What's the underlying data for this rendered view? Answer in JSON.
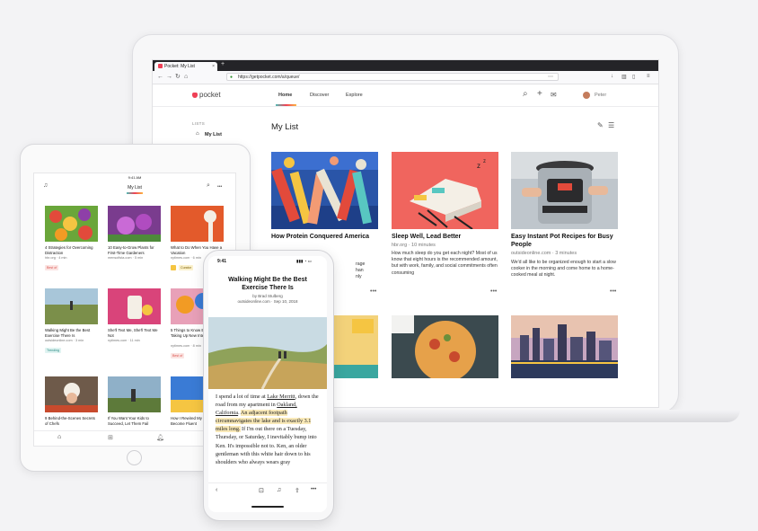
{
  "laptop": {
    "tab": {
      "title": "Pocket: My List",
      "close": "×",
      "new_tab": "+"
    },
    "url": "https://getpocket.com/a/queue/",
    "header": {
      "logo": "pocket",
      "nav": [
        "Home",
        "Discover",
        "Explore"
      ],
      "user": "Peter"
    },
    "sidebar": {
      "lists_label": "LISTS",
      "my_list": "My List"
    },
    "page_title": "My List",
    "cards": [
      {
        "title": "How Protein Conquered America",
        "source": "",
        "excerpt": "",
        "dots": "•••"
      },
      {
        "title": "Sleep Well, Lead Better",
        "source": "hbr.org · 10 minutes",
        "excerpt": "How much sleep do you get each night? Most of us know that eight hours is the recommended amount, but with work, family, and social commitments often consuming",
        "dots": "•••"
      },
      {
        "title": "Easy Instant Pot Recipes for Busy People",
        "source": "outsideonline.com · 3 minutes",
        "excerpt": "We'd all like to be organized enough to start a slow cooker in the morning and come home to a home-cooked meal at night.",
        "dots": "•••"
      }
    ],
    "card1_partial_excerpt": [
      "rage",
      "han",
      "nly"
    ]
  },
  "ipad": {
    "time": "9:41 AM",
    "title": "My List",
    "menu": "•••",
    "items": [
      {
        "title": "4 Strategies for Overcoming Distraction",
        "source": "hbr.org · 4 min",
        "badge": "Best of"
      },
      {
        "title": "10 Easy-to-Grow Plants for First-Time Gardeners",
        "source": "mensofista.com · 5 min",
        "badge": ""
      },
      {
        "title": "What to Do When You Have a Vacation",
        "source": "nytimes.com · 6 min",
        "badge": "Curator"
      },
      {
        "title": "Walking Might Be the Best Exercise There Is",
        "source": "outsideonline.com · 3 min",
        "badge": "Trending"
      },
      {
        "title": "She'll Text Me, She'll Text Me Not",
        "source": "nytimes.com · 11 min",
        "badge": ""
      },
      {
        "title": "5 Things to Know Before Taking Up New Interests",
        "source": "nytimes.com · 8 min",
        "badge": "Best of"
      },
      {
        "title": "9 Behind-the-Scenes Secrets of Chefs",
        "source": "",
        "badge": ""
      },
      {
        "title": "If You Want Your Kids to Succeed, Let Them Fail",
        "source": "",
        "badge": ""
      },
      {
        "title": "How I Rewired My Brain to Become Fluent",
        "source": "",
        "badge": ""
      }
    ]
  },
  "phone": {
    "time": "9:41",
    "title": "Walking Might Be the Best Exercise There Is",
    "byline": "by Brad Stulberg",
    "source_line": "outsideonline.com · Sep 10, 2018",
    "body": {
      "p1": "I spend a lot of time at ",
      "link1": "Lake Merritt",
      "p2": ", down the road from my apartment in ",
      "link2": "Oakland, California",
      "p3": ". ",
      "highlight": "An adjacent footpath circumnavigates the lake and is exactly 3.1 miles long.",
      "p4": " If I'm out there on a Tuesday, Thursday, or Saturday, I inevitably bump into Ken. It's impossible not to. Ken, an older gentleman with this white hair down to his shoulders who always wears gray"
    }
  }
}
